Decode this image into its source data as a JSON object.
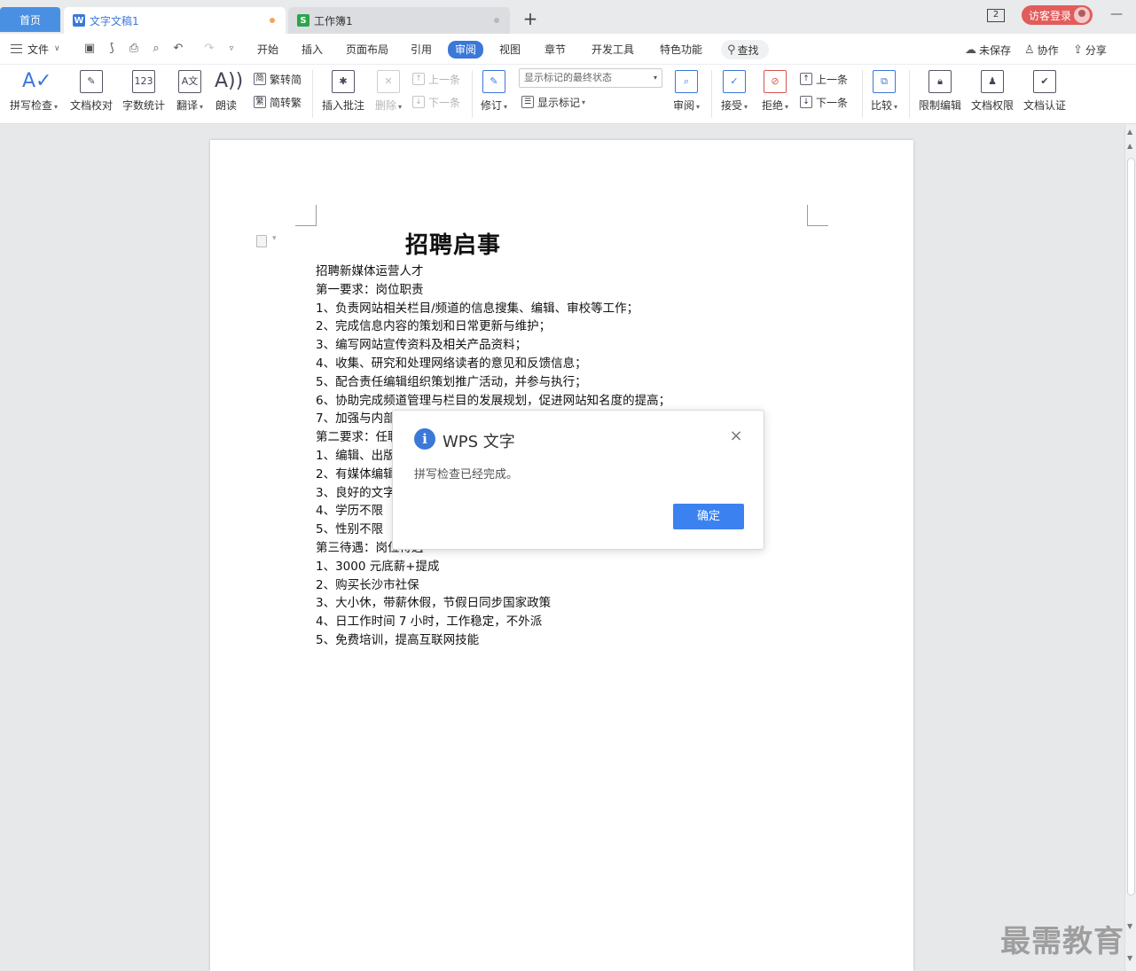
{
  "tabs": {
    "home": "首页",
    "doc1": "文字文稿1",
    "doc2": "工作簿1",
    "add": "+",
    "window_count": "2",
    "login": "访客登录",
    "minimize": "—"
  },
  "menubar": {
    "file": "文件",
    "items": [
      "开始",
      "插入",
      "页面布局",
      "引用",
      "审阅",
      "视图",
      "章节",
      "开发工具",
      "特色功能"
    ],
    "active": "审阅",
    "search": "查找",
    "unsaved": "未保存",
    "collab": "协作",
    "share": "分享"
  },
  "ribbon": {
    "spellcheck": "拼写检查",
    "proofread": "文档校对",
    "wordcount": "字数统计",
    "translate": "翻译",
    "read_aloud": "朗读",
    "trad_to_simp": "繁转简",
    "simp_to_trad": "简转繁",
    "insert_comment": "插入批注",
    "delete": "删除",
    "prev_comment": "上一条",
    "next_comment": "下一条",
    "revise": "修订",
    "markup_state": "显示标记的最终状态",
    "show_markup": "显示标记",
    "review": "审阅",
    "accept": "接受",
    "reject": "拒绝",
    "prev_change": "上一条",
    "next_change": "下一条",
    "compare": "比较",
    "restrict_edit": "限制编辑",
    "doc_permission": "文档权限",
    "doc_cert": "文档认证"
  },
  "document": {
    "title": "招聘启事",
    "lines": [
      "招聘新媒体运营人才",
      "第一要求：岗位职责",
      "1、负责网站相关栏目/频道的信息搜集、编辑、审校等工作；",
      "2、完成信息内容的策划和日常更新与维护；",
      "3、编写网站宣传资料及相关产品资料；",
      "4、收集、研究和处理网络读者的意见和反馈信息；",
      "5、配合责任编辑组织策划推广活动，并参与执行；",
      "6、协助完成频道管理与栏目的发展规划，促进网站知名度的提高；",
      "7、加强与内部",
      "第二要求：任职",
      "1、编辑、出版",
      "2、有媒体编辑",
      "3、良好的文字",
      "4、学历不限",
      "5、性别不限",
      "第三待遇：岗位待遇",
      "1、3000 元底薪+提成",
      "2、购买长沙市社保",
      "3、大小休，带薪休假，节假日同步国家政策",
      "4、日工作时间 7 小时，工作稳定，不外派",
      "5、免费培训，提高互联网技能"
    ]
  },
  "dialog": {
    "title": "WPS 文字",
    "message": "拼写检查已经完成。",
    "ok": "确定",
    "close": "×"
  },
  "watermark": "最需教育",
  "colors": {
    "accent": "#3b78d8",
    "login": "#e25c5c",
    "ok_button": "#3b82f0"
  }
}
